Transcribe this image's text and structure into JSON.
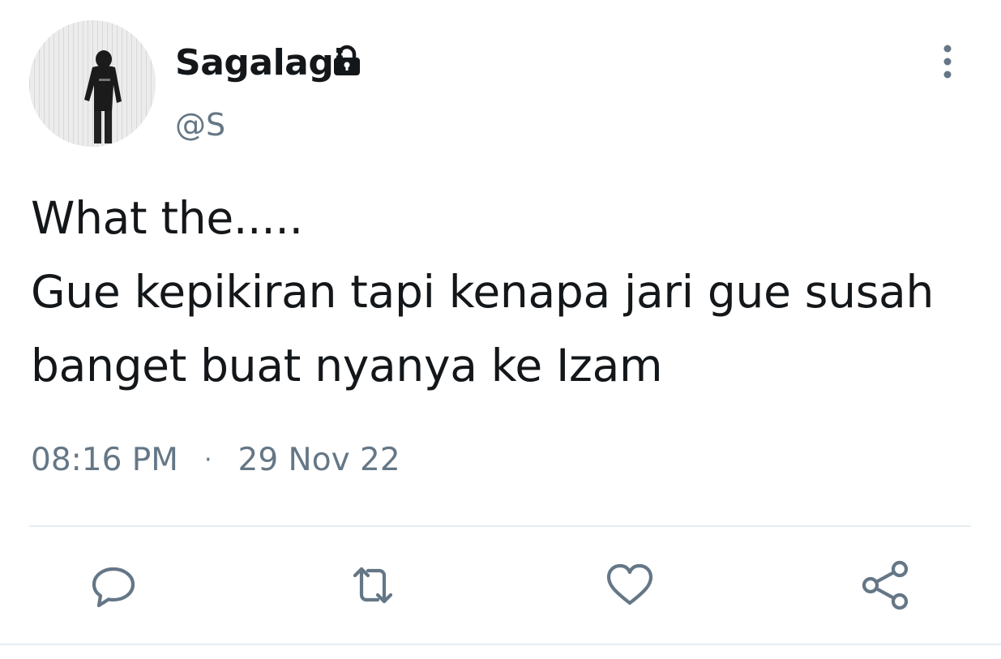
{
  "user": {
    "display_name": "Sagalagi",
    "handle": "@S",
    "locked_icon": "lock-icon",
    "avatar_icon": "avatar-photo"
  },
  "tweet": {
    "lines": [
      "What the.....",
      "Gue kepikiran tapi kenapa jari gue susah",
      "banget buat nyanya ke Izam"
    ],
    "time": "08:16 PM",
    "separator": "·",
    "date": "29 Nov 22"
  },
  "actions": {
    "reply_icon": "reply-icon",
    "retweet_icon": "retweet-icon",
    "like_icon": "heart-icon",
    "share_icon": "share-icon",
    "more_icon": "more-vertical-icon"
  },
  "colors": {
    "text_primary": "#14171a",
    "text_secondary": "#657786",
    "divider": "#e6ecf0"
  }
}
